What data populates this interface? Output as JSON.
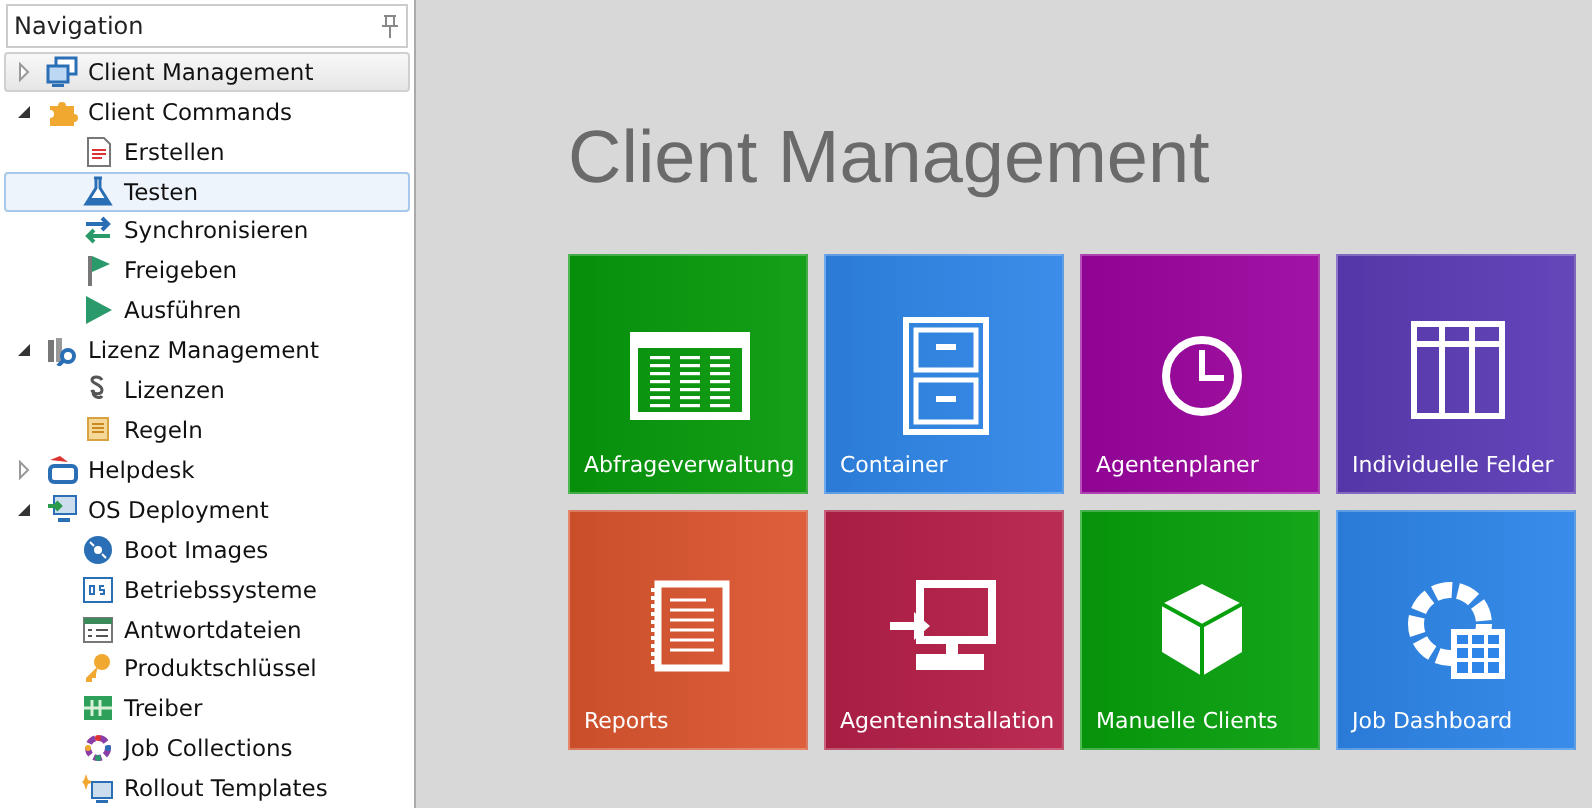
{
  "navigation": {
    "title": "Navigation",
    "items": [
      {
        "label": "Client Management",
        "expanded": false,
        "hovered": true,
        "selected": false
      },
      {
        "label": "Client Commands",
        "expanded": true,
        "hovered": false,
        "selected": false,
        "children": [
          {
            "label": "Erstellen",
            "selected": false
          },
          {
            "label": "Testen",
            "selected": true
          },
          {
            "label": "Synchronisieren",
            "selected": false
          },
          {
            "label": "Freigeben",
            "selected": false
          },
          {
            "label": "Ausführen",
            "selected": false
          }
        ]
      },
      {
        "label": "Lizenz Management",
        "expanded": true,
        "hovered": false,
        "selected": false,
        "children": [
          {
            "label": "Lizenzen",
            "selected": false
          },
          {
            "label": "Regeln",
            "selected": false
          }
        ]
      },
      {
        "label": "Helpdesk",
        "expanded": false,
        "hovered": false,
        "selected": false
      },
      {
        "label": "OS Deployment",
        "expanded": true,
        "hovered": false,
        "selected": false,
        "children": [
          {
            "label": "Boot Images",
            "selected": false
          },
          {
            "label": "Betriebssysteme",
            "selected": false
          },
          {
            "label": "Antwortdateien",
            "selected": false
          },
          {
            "label": "Produktschlüssel",
            "selected": false
          },
          {
            "label": "Treiber",
            "selected": false
          },
          {
            "label": "Job Collections",
            "selected": false
          },
          {
            "label": "Rollout Templates",
            "selected": false
          }
        ]
      }
    ]
  },
  "main": {
    "title": "Client Management",
    "tiles": [
      {
        "label": "Abfrageverwaltung",
        "color": "#069a0b"
      },
      {
        "label": "Container",
        "color": "#2f86e8"
      },
      {
        "label": "Agentenplaner",
        "color": "#9b049f"
      },
      {
        "label": "Individuelle Felder",
        "color": "#5c3bb6"
      },
      {
        "label": "Reports",
        "color": "#dc552f"
      },
      {
        "label": "Agenteninstallation",
        "color": "#b61f48"
      },
      {
        "label": "Manuelle Clients",
        "color": "#06a00c"
      },
      {
        "label": "Job Dashboard",
        "color": "#2d85e9"
      }
    ]
  }
}
